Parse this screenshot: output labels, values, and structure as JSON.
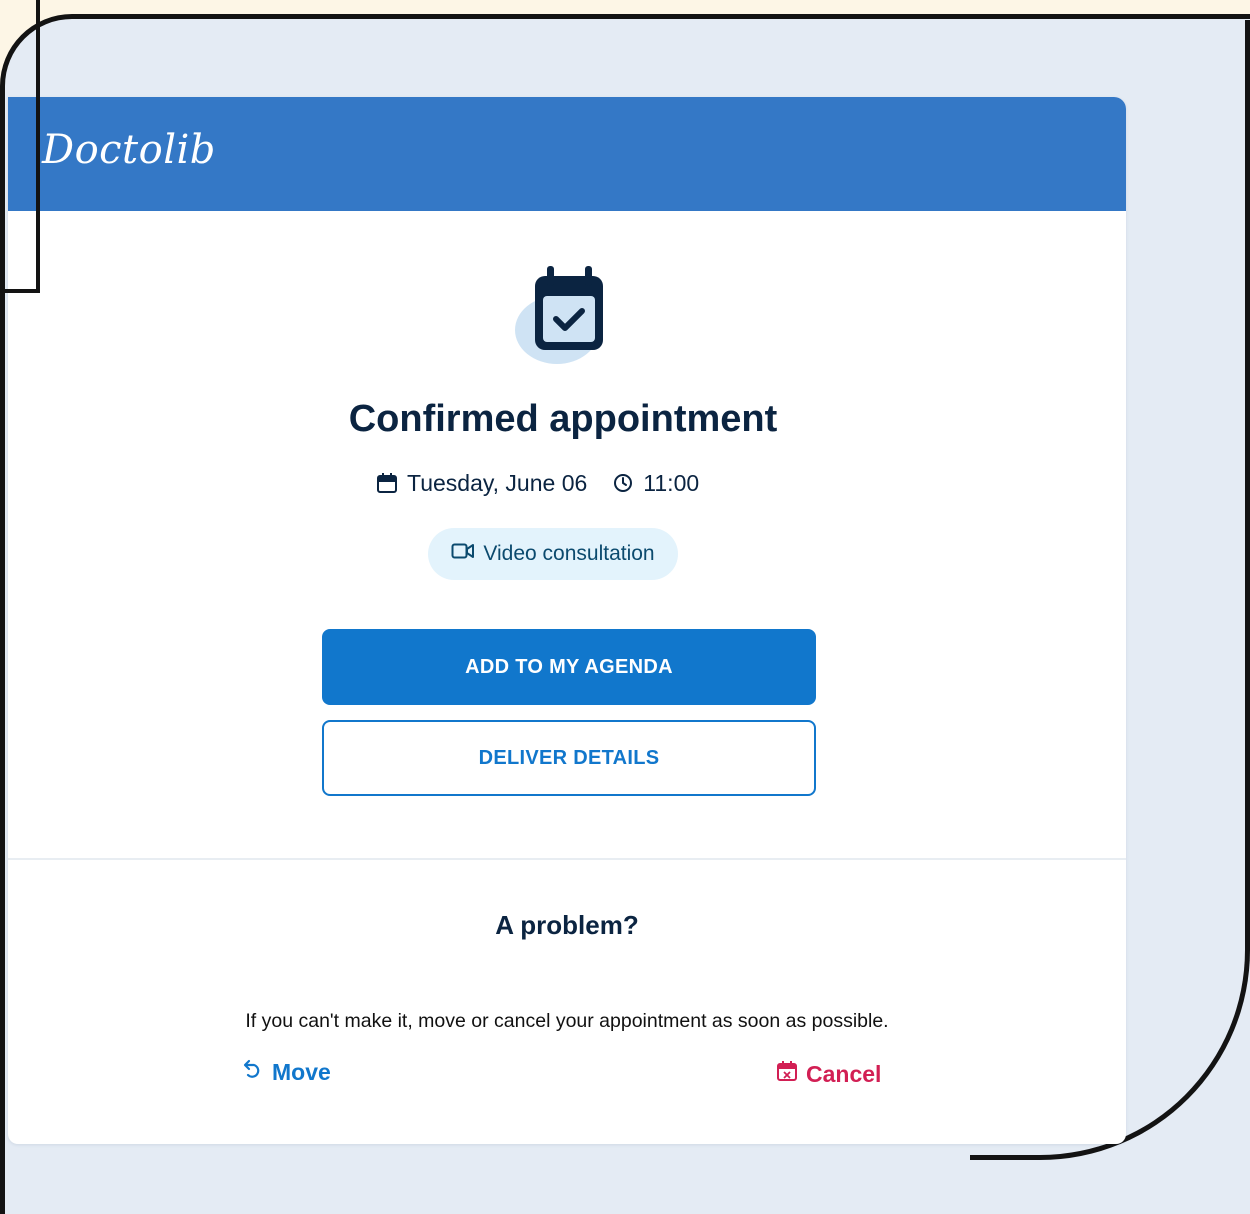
{
  "brand": {
    "logo_text": "Doctolib"
  },
  "confirmation": {
    "title": "Confirmed appointment",
    "date": "Tuesday, June 06",
    "time": "11:00",
    "consultation_type": "Video consultation"
  },
  "actions": {
    "add_to_agenda": "ADD TO MY AGENDA",
    "deliver_details": "DELIVER DETAILS"
  },
  "problem": {
    "title": "A problem?",
    "text": "If you can't make it, move or cancel your appointment as soon as possible.",
    "move_label": "Move",
    "cancel_label": "Cancel"
  },
  "colors": {
    "header_blue": "#3478c6",
    "primary_blue": "#1177cc",
    "navy": "#0b2441",
    "cancel_red": "#d21f54",
    "pill_bg": "#e3f3fc",
    "frame_bg": "#e4ebf4",
    "outer_bg": "#fdf6e6"
  },
  "icons": {
    "hero": "calendar-check-icon",
    "date": "calendar-icon",
    "time": "clock-icon",
    "video": "video-camera-icon",
    "move": "undo-arrow-icon",
    "cancel": "calendar-x-icon"
  }
}
